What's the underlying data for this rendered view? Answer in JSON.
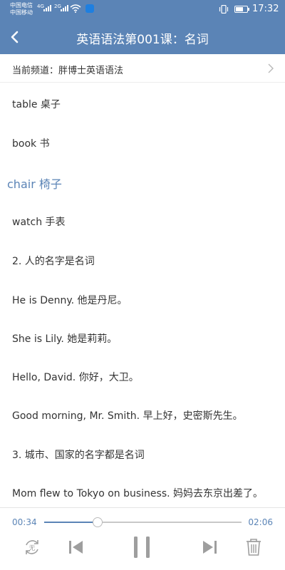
{
  "status_bar": {
    "carrier_1": "中国电信",
    "carrier_2": "中国移动",
    "network_1": "4G",
    "network_2": "2G",
    "time": "17:32"
  },
  "header": {
    "title": "英语语法第001课：名词"
  },
  "channel": {
    "label": "当前频道：胖博士英语语法"
  },
  "lines": [
    {
      "text": "table 桌子",
      "current": false
    },
    {
      "text": "book 书",
      "current": false
    },
    {
      "text": "chair 椅子",
      "current": true
    },
    {
      "text": "watch 手表",
      "current": false
    },
    {
      "text": "2. 人的名字是名词",
      "current": false
    },
    {
      "text": "He is Denny. 他是丹尼。",
      "current": false
    },
    {
      "text": "She is Lily. 她是莉莉。",
      "current": false
    },
    {
      "text": "Hello, David. 你好，大卫。",
      "current": false
    },
    {
      "text": "Good morning, Mr. Smith. 早上好，史密斯先生。",
      "current": false
    },
    {
      "text": "3. 城市、国家的名字都是名词",
      "current": false
    },
    {
      "text": "Mom flew to Tokyo on business. 妈妈去东京出差了。",
      "current": false
    }
  ],
  "player": {
    "elapsed": "00:34",
    "total": "02:06",
    "progress": 0.27,
    "mode_icon_label": "无"
  },
  "colors": {
    "accent": "#5b84b6",
    "text": "#333333",
    "icon_gray": "#9e9e9e"
  },
  "icons": {
    "back": "chevron-left-icon",
    "channel": "chevron-right-icon",
    "mode": "repeat-none-icon",
    "prev": "skip-previous-icon",
    "pause": "pause-icon",
    "next": "skip-next-icon",
    "delete": "trash-icon"
  }
}
